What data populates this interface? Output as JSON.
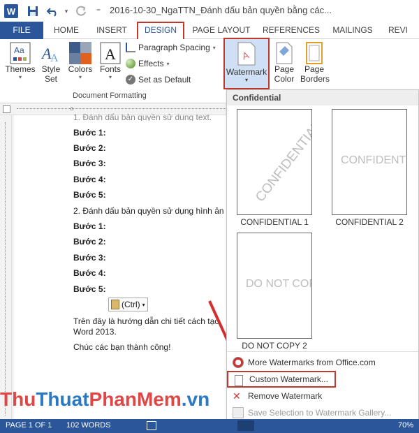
{
  "titlebar": {
    "app_logo": "W",
    "title": "2016-10-30_NgaTTN_Đánh dấu bản quyền bằng các..."
  },
  "tabs": [
    {
      "label": "FILE"
    },
    {
      "label": "HOME"
    },
    {
      "label": "INSERT"
    },
    {
      "label": "DESIGN"
    },
    {
      "label": "PAGE LAYOUT"
    },
    {
      "label": "REFERENCES"
    },
    {
      "label": "MAILINGS"
    },
    {
      "label": "REVI"
    }
  ],
  "ribbon": {
    "themes": "Themes",
    "style_set_1": "Style",
    "style_set_2": "Set",
    "colors": "Colors",
    "fonts": "Fonts",
    "paragraph_spacing": "Paragraph Spacing",
    "effects": "Effects",
    "set_default": "Set as Default",
    "group_label": "Document Formatting",
    "watermark": "Watermark",
    "page_color_1": "Page",
    "page_color_2": "Color",
    "page_borders_1": "Page",
    "page_borders_2": "Borders"
  },
  "document": {
    "top_cut": "1. Đánh dấu bản quyền sử dụng text.",
    "steps_a": [
      "Bước 1:",
      "Bước 2:",
      "Bước 3:",
      "Bước 4:",
      "Bước 5:"
    ],
    "section2": "2. Đánh dấu bản quyền sử dụng hình ản",
    "steps_b": [
      "Bước 1:",
      "Bước 2:",
      "Bước 3:",
      "Bước 4:",
      "Bước 5:"
    ],
    "paste_ctrl": "(Ctrl)",
    "closing_1": "Trên đây là hướng dẫn chi tiết cách tạo",
    "closing_2": "Word 2013.",
    "closing_3": "Chúc các bạn thành công!"
  },
  "gallery": {
    "header": "Confidential",
    "thumbs": [
      {
        "text": "CONFIDENTIAL",
        "label": "CONFIDENTIAL 1"
      },
      {
        "text": "CONFIDENTIAL",
        "label": "CONFIDENTIAL 2"
      },
      {
        "text": "DO NOT COPY",
        "label": "DO NOT COPY 2"
      }
    ],
    "menu": [
      {
        "label": "More Watermarks from Office.com"
      },
      {
        "label": "Custom Watermark..."
      },
      {
        "label": "Remove Watermark"
      },
      {
        "label": "Save Selection to Watermark Gallery..."
      }
    ]
  },
  "status": {
    "page": "PAGE 1 OF 1",
    "words": "102 WORDS",
    "zoom": "70%"
  },
  "brand": {
    "part1": "Thu",
    "part2": "Thuat",
    "part3": "PhanMem",
    "part4": ".vn"
  },
  "colors": {
    "accent": "#2b579a",
    "highlight_box": "#c0392b"
  }
}
